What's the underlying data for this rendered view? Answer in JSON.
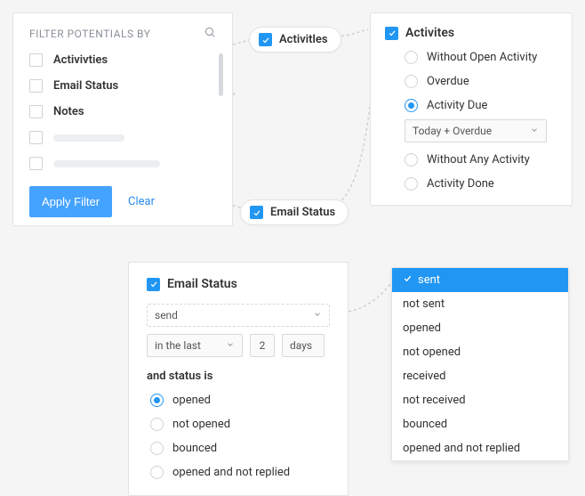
{
  "filterPanel": {
    "title": "FILTER POTENTIALS BY",
    "items": [
      "Activivties",
      "Email Status",
      "Notes"
    ],
    "applyLabel": "Apply Filter",
    "clearLabel": "Clear"
  },
  "pillActivities": {
    "label": "Activitles"
  },
  "pillEmail": {
    "label": "Email Status"
  },
  "activitiesPanel": {
    "header": "Activites",
    "options": [
      "Without Open Activity",
      "Overdue",
      "Activity Due",
      "Without Any Activity",
      "Activity Done"
    ],
    "selectedIndex": 2,
    "dueSelectValue": "Today + Overdue"
  },
  "emailPanel": {
    "header": "Email Status",
    "primarySelect": "send",
    "inLastLabel": "in the last",
    "numValue": "2",
    "unitLabel": "days",
    "andStatusLabel": "and status is",
    "statusOptions": [
      "opened",
      "not opened",
      "bounced",
      "opened and not replied"
    ],
    "statusSelectedIndex": 0
  },
  "dropdown": {
    "items": [
      "sent",
      "not sent",
      "opened",
      "not opened",
      "received",
      "not received",
      "bounced",
      "opened and not replied"
    ],
    "selectedIndex": 0
  }
}
